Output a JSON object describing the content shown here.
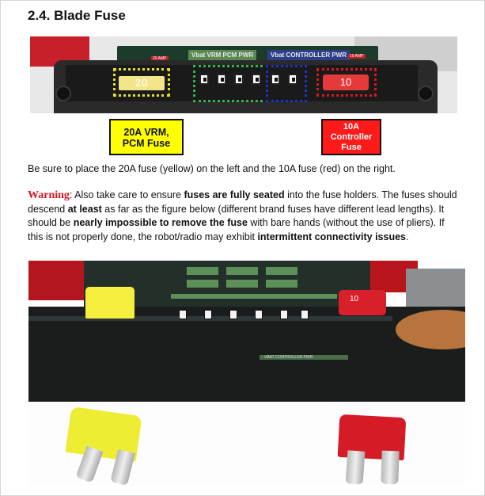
{
  "section": {
    "heading": "2.4. Blade Fuse"
  },
  "top_photo": {
    "label_green": "Vbat VRM PCM PWR",
    "label_blue": "Vbat CONTROLLER PWR",
    "tag_left": "20 AMP",
    "tag_right": "10 AMP",
    "fuse_left_value": "20",
    "fuse_right_value": "10",
    "highlight_colors": {
      "yellow": "#e5e021",
      "green": "#2fb34a",
      "blue": "#1c34c6",
      "red": "#e0161e"
    }
  },
  "callouts": {
    "yellow_line1": "20A VRM,",
    "yellow_line2": "PCM Fuse",
    "red_line1": "10A",
    "red_line2": "Controller",
    "red_line3": "Fuse"
  },
  "paragraph1": "Be sure to place the 20A fuse (yellow) on the left and the 10A fuse (red) on the right.",
  "warning": {
    "label": "Warning",
    "t1": ": Also take care to ensure ",
    "b1": "fuses are fully seated",
    "t2": " into the fuse holders.  The fuses should descend ",
    "b2": "at least",
    "t3": " as far as the figure below (different brand fuses have different lead lengths).  It should be ",
    "b3": "nearly impossible to remove the fuse",
    "t4": " with bare hands (without the use of pliers).  If this is not properly done, the robot/radio may exhibit ",
    "b4": "intermittent connectivity issues",
    "t5": "."
  },
  "bottom_photo": {
    "strip_text": "VBAT CONTROLLER PWR",
    "red_fuse_value": "10"
  }
}
